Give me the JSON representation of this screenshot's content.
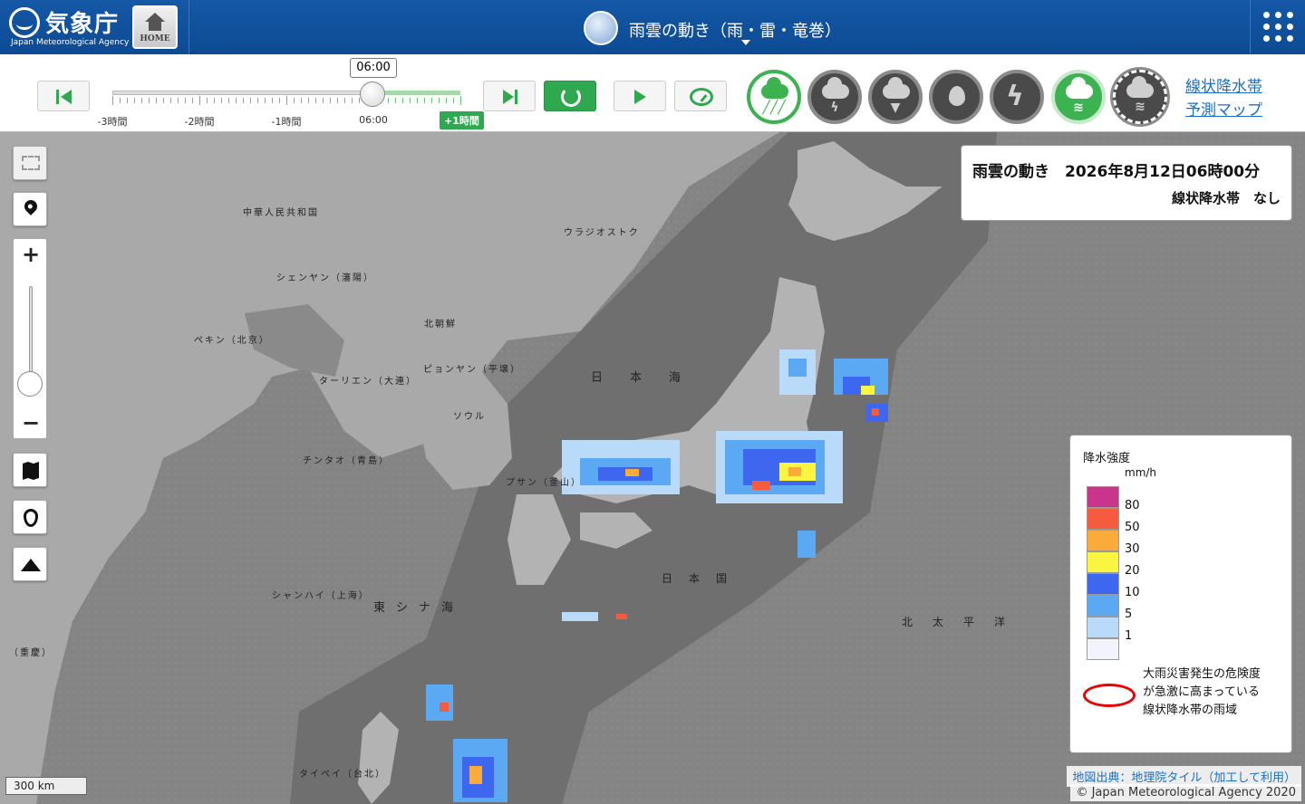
{
  "header": {
    "logo_text": "気象庁",
    "logo_sub": "Japan Meteorological Agency",
    "home_label": "HOME",
    "title": "雨雲の動き（雨・雷・竜巻）"
  },
  "timeline": {
    "current_time": "06:00",
    "labels": [
      "-3時間",
      "-2時間",
      "-1時間",
      "06:00"
    ],
    "future_label": "+1時間"
  },
  "modes": [
    {
      "icon": "rain-cloud-icon",
      "state": "active"
    },
    {
      "icon": "thunder-cloud-icon",
      "state": "inactive"
    },
    {
      "icon": "tornado-cloud-icon",
      "state": "inactive"
    },
    {
      "icon": "drop-icon",
      "state": "inactive"
    },
    {
      "icon": "lightning-icon",
      "state": "inactive"
    },
    {
      "icon": "linear-rainband-icon",
      "state": "active"
    },
    {
      "icon": "linear-rainband-forecast-icon",
      "state": "inactive"
    }
  ],
  "links": {
    "forecast_line1": "線状降水帯",
    "forecast_line2": "予測マップ"
  },
  "info": {
    "title": "雨雲の動き　2026年8月12日06時00分",
    "status": "線状降水帯　なし"
  },
  "legend": {
    "title": "降水強度",
    "unit": "mm/h",
    "levels": [
      {
        "value": "80",
        "color": "#c9348c"
      },
      {
        "value": "50",
        "color": "#f55b3c"
      },
      {
        "value": "30",
        "color": "#fbab39"
      },
      {
        "value": "20",
        "color": "#faf541"
      },
      {
        "value": "10",
        "color": "#3d67ef"
      },
      {
        "value": "5",
        "color": "#5ba8f3"
      },
      {
        "value": "1",
        "color": "#b9daf8"
      },
      {
        "value": "",
        "color": "#f3f3fb"
      }
    ],
    "linear_note": [
      "大雨災害発生の危険度",
      "が急激に高まっている",
      "線状降水帯の雨域"
    ]
  },
  "map": {
    "scale": "300 km",
    "credit": "地図出典：地理院タイル（加工して利用）",
    "copyright": "© Japan Meteorological Agency 2020",
    "labels": {
      "china": "中華人民共和国",
      "vladivostok": "ウラジオストク",
      "shenyang": "シェンヤン（瀋陽）",
      "north_korea": "北朝鮮",
      "beijing": "ペキン（北京）",
      "dalian": "ターリエン（大連）",
      "pyongyang": "ピョンヤン（平壌）",
      "seoul": "ソウル",
      "qingdao": "チンタオ（青島）",
      "busan": "プサン（釜山）",
      "shanghai": "シャンハイ（上海）",
      "east_china_sea": "東シナ海",
      "sea_of_japan": "日本海",
      "japan": "日本国",
      "pacific": "北太平洋",
      "chongqing": "（重慶）",
      "taipei": "タイペイ（台北）"
    }
  }
}
